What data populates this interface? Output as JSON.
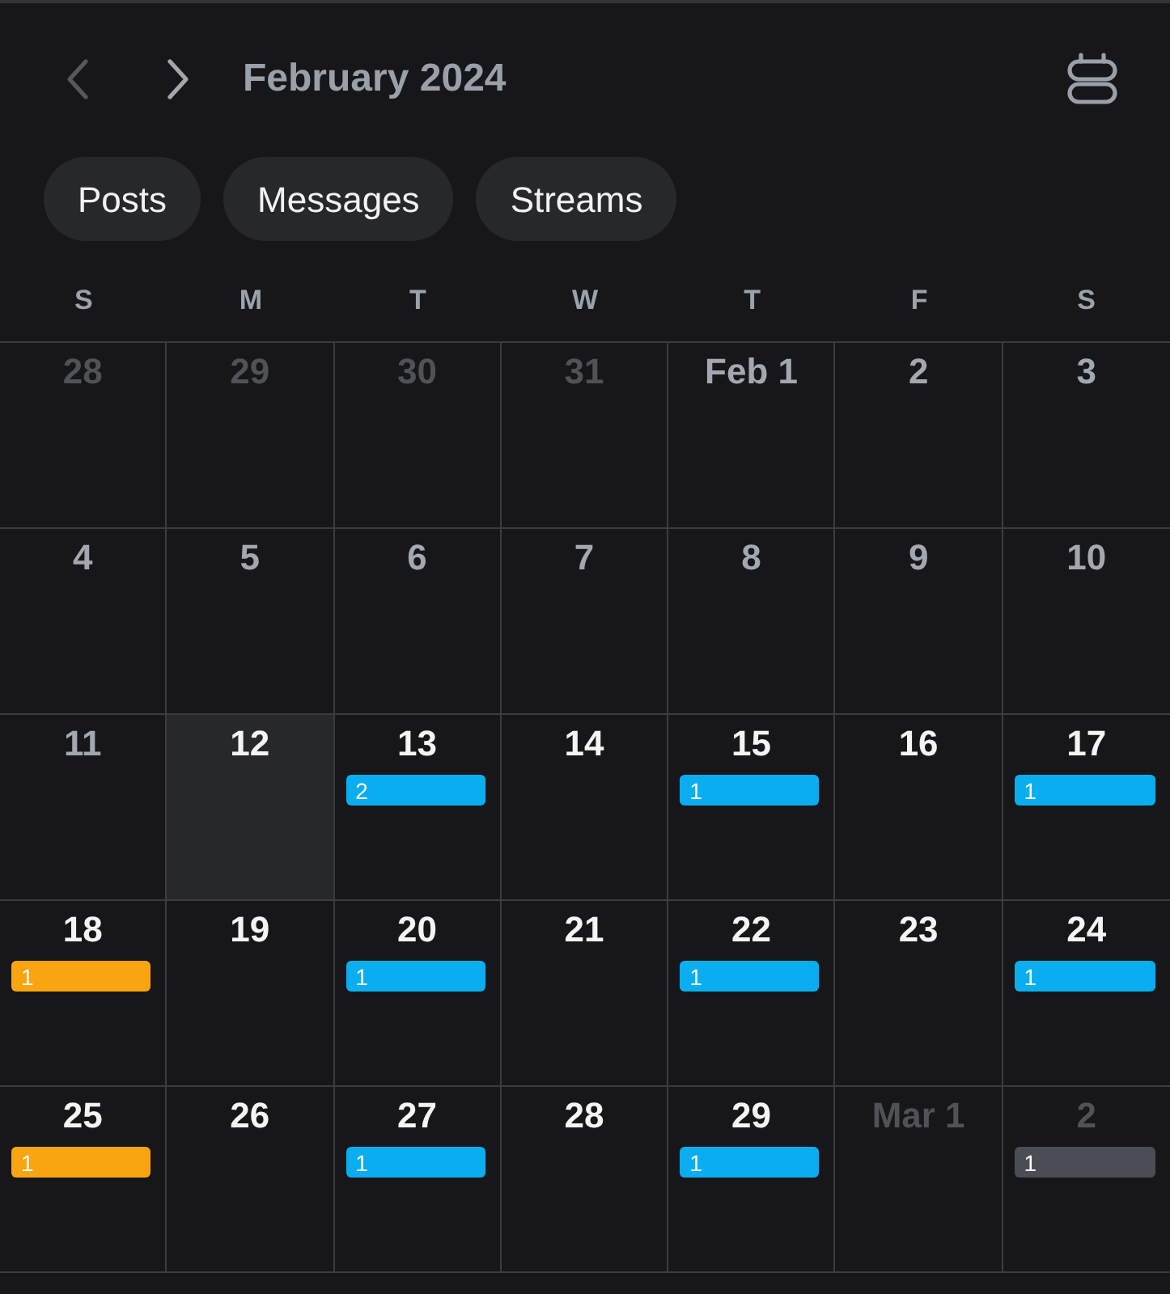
{
  "header": {
    "prev_button": {
      "disabled": true
    },
    "next_button": {
      "disabled": false
    },
    "title": "February 2024"
  },
  "filters": [
    {
      "label": "Posts"
    },
    {
      "label": "Messages"
    },
    {
      "label": "Streams"
    }
  ],
  "weekdays": [
    "S",
    "M",
    "T",
    "W",
    "T",
    "F",
    "S"
  ],
  "weeks": [
    {
      "days": [
        {
          "label": "28",
          "kind": "outside"
        },
        {
          "label": "29",
          "kind": "outside"
        },
        {
          "label": "30",
          "kind": "outside"
        },
        {
          "label": "31",
          "kind": "outside"
        },
        {
          "label": "Feb 1",
          "kind": "past"
        },
        {
          "label": "2",
          "kind": "past"
        },
        {
          "label": "3",
          "kind": "past"
        }
      ]
    },
    {
      "days": [
        {
          "label": "4",
          "kind": "past"
        },
        {
          "label": "5",
          "kind": "past"
        },
        {
          "label": "6",
          "kind": "past"
        },
        {
          "label": "7",
          "kind": "past"
        },
        {
          "label": "8",
          "kind": "past"
        },
        {
          "label": "9",
          "kind": "past"
        },
        {
          "label": "10",
          "kind": "past"
        }
      ]
    },
    {
      "days": [
        {
          "label": "11",
          "kind": "past"
        },
        {
          "label": "12",
          "kind": "today"
        },
        {
          "label": "13",
          "kind": "upcoming",
          "events": [
            {
              "count": "2",
              "color": "#0aaef0"
            }
          ]
        },
        {
          "label": "14",
          "kind": "upcoming"
        },
        {
          "label": "15",
          "kind": "upcoming",
          "events": [
            {
              "count": "1",
              "color": "#0aaef0"
            }
          ]
        },
        {
          "label": "16",
          "kind": "upcoming"
        },
        {
          "label": "17",
          "kind": "upcoming",
          "events": [
            {
              "count": "1",
              "color": "#0aaef0"
            }
          ]
        }
      ]
    },
    {
      "days": [
        {
          "label": "18",
          "kind": "upcoming",
          "events": [
            {
              "count": "1",
              "color": "#f9a411"
            }
          ]
        },
        {
          "label": "19",
          "kind": "upcoming"
        },
        {
          "label": "20",
          "kind": "upcoming",
          "events": [
            {
              "count": "1",
              "color": "#0aaef0"
            }
          ]
        },
        {
          "label": "21",
          "kind": "upcoming"
        },
        {
          "label": "22",
          "kind": "upcoming",
          "events": [
            {
              "count": "1",
              "color": "#0aaef0"
            }
          ]
        },
        {
          "label": "23",
          "kind": "upcoming"
        },
        {
          "label": "24",
          "kind": "upcoming",
          "events": [
            {
              "count": "1",
              "color": "#0aaef0"
            }
          ]
        }
      ]
    },
    {
      "days": [
        {
          "label": "25",
          "kind": "upcoming",
          "events": [
            {
              "count": "1",
              "color": "#f9a411"
            }
          ]
        },
        {
          "label": "26",
          "kind": "upcoming"
        },
        {
          "label": "27",
          "kind": "upcoming",
          "events": [
            {
              "count": "1",
              "color": "#0aaef0"
            }
          ]
        },
        {
          "label": "28",
          "kind": "upcoming"
        },
        {
          "label": "29",
          "kind": "upcoming",
          "events": [
            {
              "count": "1",
              "color": "#0aaef0"
            }
          ]
        },
        {
          "label": "Mar 1",
          "kind": "outside"
        },
        {
          "label": "2",
          "kind": "outside",
          "events": [
            {
              "count": "1",
              "color": "#4a4d54"
            }
          ]
        }
      ]
    }
  ]
}
